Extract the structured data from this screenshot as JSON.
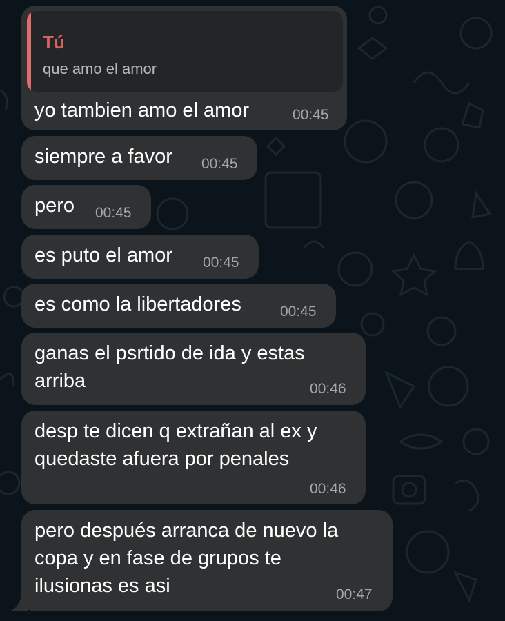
{
  "reply": {
    "author": "Tú",
    "text": "que amo el amor"
  },
  "messages": [
    {
      "text": "yo tambien amo el amor",
      "time": "00:45"
    },
    {
      "text": "siempre a favor",
      "time": "00:45"
    },
    {
      "text": "pero",
      "time": "00:45"
    },
    {
      "text": "es puto el amor",
      "time": "00:45"
    },
    {
      "text": "es como la libertadores",
      "time": "00:45"
    },
    {
      "text_lines": [
        "ganas el psrtido de ida y estas",
        "arriba"
      ],
      "time": "00:46"
    },
    {
      "text_lines": [
        "desp te dicen q extrañan al ex y",
        "quedaste afuera por penales"
      ],
      "time": "00:46"
    },
    {
      "text_lines": [
        "pero después arranca de nuevo la",
        "copa y en fase de grupos te",
        "ilusionas es asi"
      ],
      "time": "00:47"
    }
  ],
  "colors": {
    "background": "#0b141a",
    "bubble": "#303132",
    "quote_bar": "#e06d6d",
    "quote_author": "#d86363",
    "timestamp": "#a4a6a8"
  }
}
